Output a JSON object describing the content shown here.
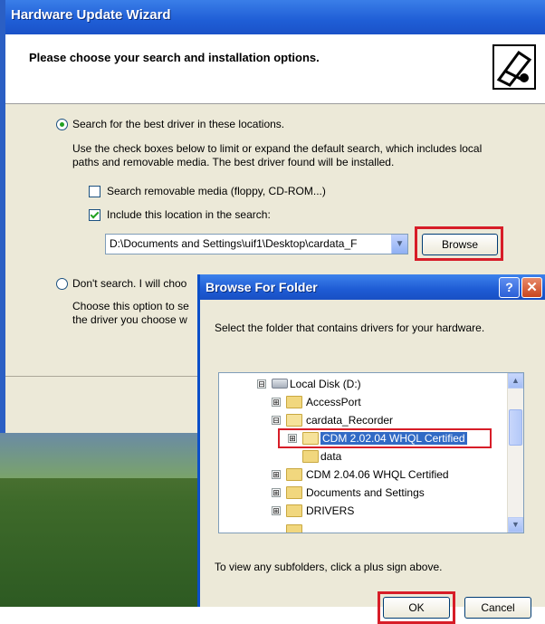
{
  "wizard": {
    "title": "Hardware Update Wizard",
    "header": "Please choose your search and installation options.",
    "option_search": "Search for the best driver in these locations.",
    "search_desc_1": "Use the check boxes below to limit or expand the default search, which includes local",
    "search_desc_2": "paths and removable media. The best driver found will be installed.",
    "checkbox_removable": "Search removable media (floppy, CD-ROM...)",
    "checkbox_include": "Include this location in the search:",
    "location_value": "D:\\Documents and Settings\\uif1\\Desktop\\cardata_F",
    "browse_label": "Browse",
    "option_dont_search": "Don't search. I will choo",
    "dont_desc_1": "Choose this option to se",
    "dont_desc_2": "the driver you choose w"
  },
  "browse_dialog": {
    "title": "Browse For Folder",
    "help_label": "?",
    "close_label": "✕",
    "description": "Select the folder that contains drivers for your hardware.",
    "tree": [
      {
        "label": "Local Disk (D:)",
        "expander": "⊟"
      },
      {
        "label": "AccessPort",
        "expander": "⊞"
      },
      {
        "label": "cardata_Recorder",
        "expander": "⊟"
      },
      {
        "label": "CDM 2.02.04 WHQL Certified",
        "expander": "⊞",
        "selected": true
      },
      {
        "label": "data",
        "expander": ""
      },
      {
        "label": "CDM 2.04.06 WHQL Certified",
        "expander": "⊞"
      },
      {
        "label": "Documents and Settings",
        "expander": "⊞"
      },
      {
        "label": "DRIVERS",
        "expander": "⊞"
      }
    ],
    "hint": "To view any subfolders, click a plus sign above.",
    "ok_label": "OK",
    "cancel_label": "Cancel"
  },
  "colors": {
    "titlebar": "#1f5ed6",
    "highlight_box": "#d71d28",
    "selection": "#316ac5"
  }
}
